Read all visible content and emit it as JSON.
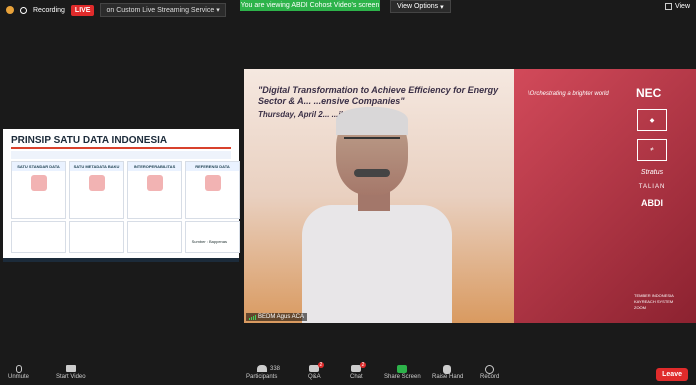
{
  "topbar": {
    "recording": "Recording",
    "live": "LIVE",
    "stream": "on Custom Live Streaming Service",
    "viewing": "You are viewing ABDI Cohost Video's screen",
    "view_options": "View Options",
    "view": "View"
  },
  "shared_screen": {
    "title": "PRINSIP SATU DATA INDONESIA",
    "cards": [
      "SATU STANDAR DATA",
      "SATU METADATA BAKU",
      "INTEROPERABILITAS",
      "REFERENSI DATA"
    ],
    "source": "Sumber : Bappenas"
  },
  "video": {
    "title": "\"Digital Transformation to Achieve Efficiency for Energy Sector & A... ...ensive Companies\"",
    "subtitle": "Thursday, April 2... ...jkt time",
    "tagline": "\\Orchestrating a brighter world",
    "logos": {
      "nec": "NEC",
      "stratus": "Stratus",
      "talian": "TALIAN",
      "abdi": "ABDI",
      "small1": "TEMBER INDONESIA",
      "small2": "KAYREACH SYSTEM   ZOOM"
    },
    "participant_name": "BEDM Agus ACA"
  },
  "toolbar": {
    "unmute": "Unmute",
    "start_video": "Start Video",
    "participants": "Participants",
    "participants_count": "338",
    "qa": "Q&A",
    "qa_badge": "2",
    "chat": "Chat",
    "chat_badge": "2",
    "share": "Share Screen",
    "raise_hand": "Raise Hand",
    "record": "Record",
    "leave": "Leave"
  }
}
